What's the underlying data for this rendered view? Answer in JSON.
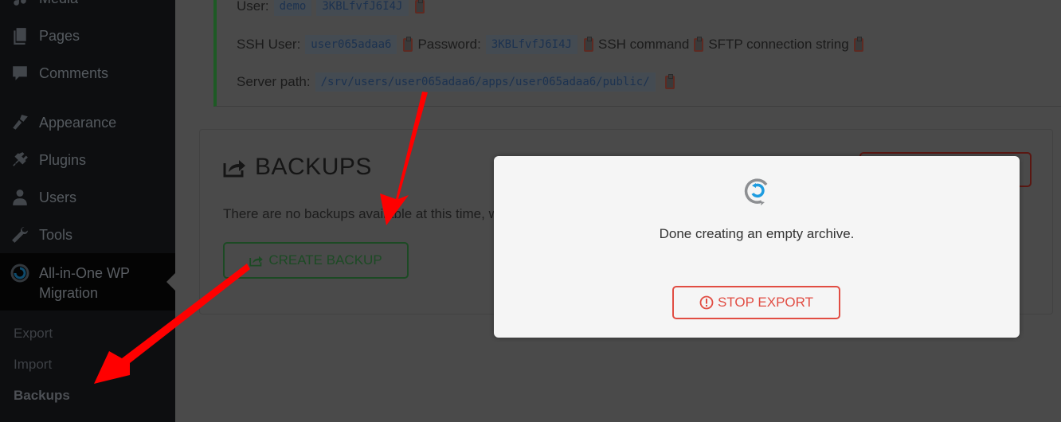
{
  "sidebar": {
    "items": [
      {
        "label": "Media",
        "icon": "media-icon"
      },
      {
        "label": "Pages",
        "icon": "pages-icon"
      },
      {
        "label": "Comments",
        "icon": "comments-icon"
      },
      {
        "label": "Appearance",
        "icon": "appearance-icon"
      },
      {
        "label": "Plugins",
        "icon": "plugins-icon"
      },
      {
        "label": "Users",
        "icon": "users-icon"
      },
      {
        "label": "Tools",
        "icon": "tools-icon"
      }
    ],
    "current": {
      "label_line1": "All-in-One WP",
      "label_line2": "Migration",
      "icon": "ai1wm-logo-icon"
    },
    "submenu": [
      {
        "label": "Export"
      },
      {
        "label": "Import"
      },
      {
        "label": "Backups",
        "current": true
      }
    ]
  },
  "credentials": {
    "user_label": "User:",
    "user_value": "demo",
    "user_password": "3KBLfvfJ6I4J",
    "ssh_user_label": "SSH User:",
    "ssh_user_value": "user065adaa6",
    "password_label": "Password:",
    "password_value": "3KBLfvfJ6I4J",
    "ssh_command_label": "SSH command",
    "sftp_label": "SFTP connection string",
    "server_path_label": "Server path:",
    "server_path_value": "/srv/users/user065adaa6/apps/user065adaa6/public/"
  },
  "backups": {
    "title": "BACKUPS",
    "empty_message": "There are no backups available at this time, why not create a new backup?",
    "create_button": "CREATE BACKUP"
  },
  "modal": {
    "message": "Done creating an empty archive.",
    "stop_button": "STOP EXPORT"
  },
  "colors": {
    "success_green": "#1c4a24",
    "danger_red": "#e14d43",
    "annotation_red": "#ff0000",
    "spinner_blue": "#1e9ce0"
  }
}
